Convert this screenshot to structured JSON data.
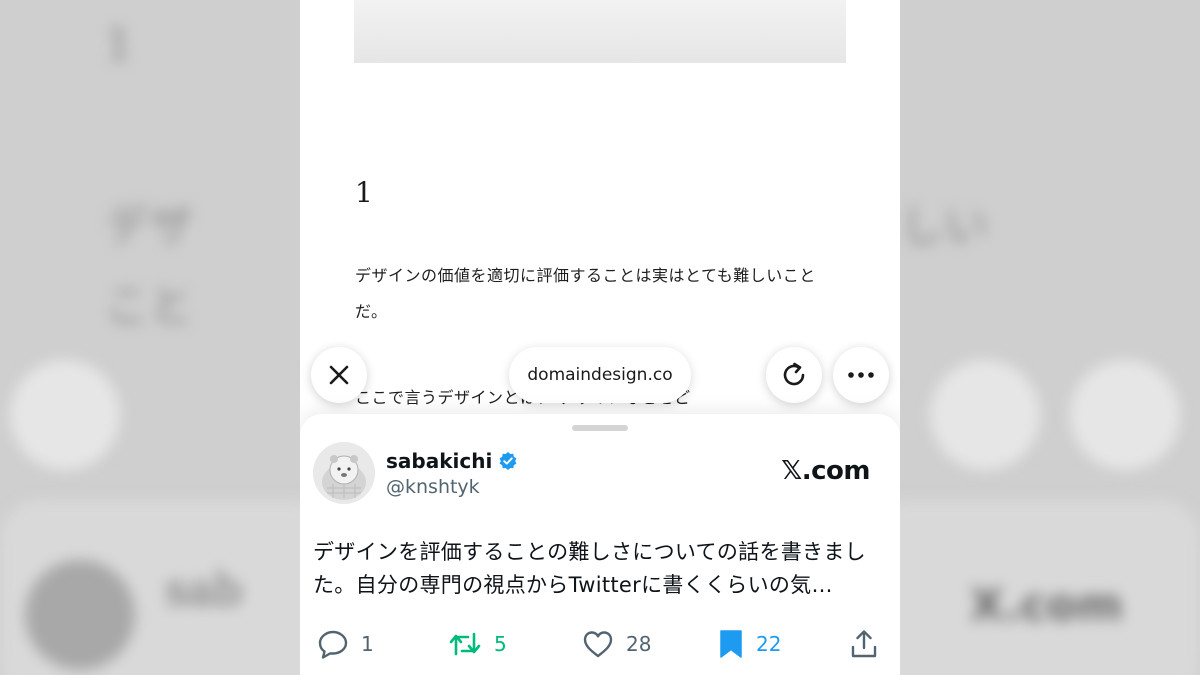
{
  "article": {
    "number": "1",
    "paragraph_1": "デザインの価値を適切に評価することは実はとても難しいことだ。",
    "paragraph_2_partial": "ここで言うデザインとは、 デザインなどをど"
  },
  "browser": {
    "url": "domaindesign.co",
    "close_icon": "close-icon",
    "reload_icon": "reload-icon",
    "more_icon": "more-icon"
  },
  "tweet": {
    "display_name": "sabakichi",
    "handle": "@knshtyk",
    "verified": true,
    "source": "𝕏.com",
    "text": "デザインを評価することの難しさについての話を書きました。自分の専門の視点からTwitterに書くくらいの気…",
    "replies": "1",
    "retweets": "5",
    "likes": "28",
    "bookmarks": "22"
  },
  "colors": {
    "verified_badge": "#1d9bf0",
    "retweet_active": "#00ba7c",
    "bookmark_active": "#1d9bf0",
    "muted": "#536471"
  }
}
